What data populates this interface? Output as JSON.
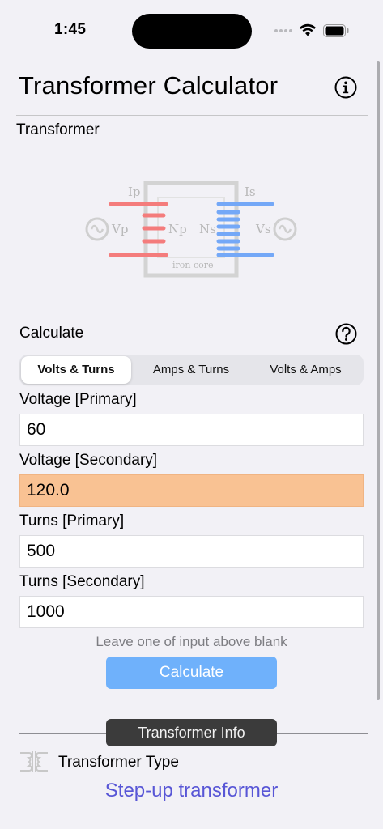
{
  "status_bar": {
    "time": "1:45"
  },
  "header": {
    "title": "Transformer Calculator"
  },
  "transformer_section": {
    "label": "Transformer",
    "diagram": {
      "ip": "Ip",
      "is": "Is",
      "vp": "Vp",
      "vs": "Vs",
      "np": "Np",
      "ns": "Ns",
      "core": "iron core",
      "colors": {
        "primary": "#f47c7c",
        "secondary": "#74a8f7",
        "core": "#d0d0d0",
        "text": "#b8b8b8"
      }
    }
  },
  "calculate_section": {
    "label": "Calculate",
    "tabs": [
      {
        "label": "Volts & Turns",
        "selected": true
      },
      {
        "label": "Amps & Turns",
        "selected": false
      },
      {
        "label": "Volts & Amps",
        "selected": false
      }
    ]
  },
  "fields": {
    "voltage_primary": {
      "label": "Voltage [Primary]",
      "value": "60"
    },
    "voltage_secondary": {
      "label": "Voltage [Secondary]",
      "value": "120.0"
    },
    "turns_primary": {
      "label": "Turns [Primary]",
      "value": "500"
    },
    "turns_secondary": {
      "label": "Turns [Secondary]",
      "value": "1000"
    }
  },
  "hint": "Leave one of input above blank",
  "calculate_button": "Calculate",
  "info_section": {
    "chip": "Transformer Info",
    "type_label": "Transformer Type",
    "type_value": "Step-up transformer"
  },
  "colors": {
    "accent": "#6fb1fb",
    "result_field": "#f9c293",
    "type_value": "#5856d6"
  }
}
